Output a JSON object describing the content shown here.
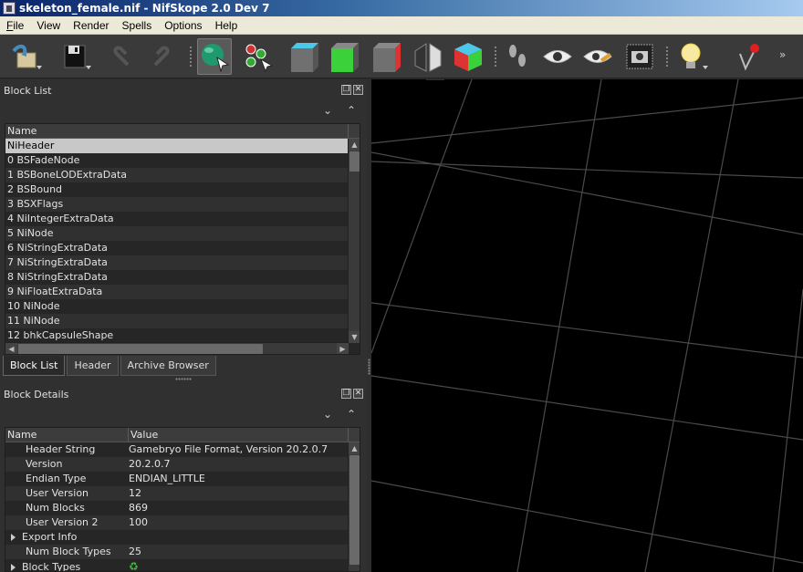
{
  "window": {
    "title": "skeleton_female.nif - NifSkope 2.0 Dev 7"
  },
  "menu": [
    {
      "label": "File",
      "mnemonic": "F",
      "rest": "ile"
    },
    {
      "label": "View",
      "mnemonic": "",
      "rest": "View"
    },
    {
      "label": "Render",
      "mnemonic": "",
      "rest": "Render"
    },
    {
      "label": "Spells",
      "mnemonic": "",
      "rest": "Spells"
    },
    {
      "label": "Options",
      "mnemonic": "",
      "rest": "Options"
    },
    {
      "label": "Help",
      "mnemonic": "",
      "rest": "Help"
    }
  ],
  "toolbar": {
    "icons": [
      "open-file-icon",
      "save-file-icon",
      "undo-icon",
      "redo-icon",
      "select-object-icon",
      "select-vertex-icon",
      "view-top-icon",
      "view-front-icon",
      "view-side-icon",
      "view-walk-icon",
      "view-flip-icon",
      "footprint-icon",
      "eye-icon",
      "eye-edit-icon",
      "screenshot-icon",
      "lightbulb-icon",
      "pin-icon"
    ],
    "more": "»",
    "colors": {
      "accent": "#2aa37a",
      "green": "#3ad13a",
      "red": "#d33",
      "cyan": "#4cc7e8"
    }
  },
  "block_list": {
    "title": "Block List",
    "header": {
      "name": "Name"
    },
    "rows": [
      "NiHeader",
      "0 BSFadeNode",
      "1 BSBoneLODExtraData",
      "2 BSBound",
      "3 BSXFlags",
      "4 NiIntegerExtraData",
      "5 NiNode",
      "6 NiStringExtraData",
      "7 NiStringExtraData",
      "8 NiStringExtraData",
      "9 NiFloatExtraData",
      "10 NiNode",
      "11 NiNode",
      "12 bhkCapsuleShape"
    ],
    "selected_index": 0
  },
  "tabs": [
    "Block List",
    "Header",
    "Archive Browser"
  ],
  "block_details": {
    "title": "Block Details",
    "header": {
      "name": "Name",
      "value": "Value"
    },
    "rows": [
      {
        "name": "Header String",
        "value": "Gamebryo File Format, Version 20.2.0.7",
        "expandable": false
      },
      {
        "name": "Version",
        "value": "20.2.0.7",
        "expandable": false
      },
      {
        "name": "Endian Type",
        "value": "ENDIAN_LITTLE",
        "expandable": false
      },
      {
        "name": "User Version",
        "value": "12",
        "expandable": false
      },
      {
        "name": "Num Blocks",
        "value": "869",
        "expandable": false
      },
      {
        "name": "User Version 2",
        "value": "100",
        "expandable": false
      },
      {
        "name": "Export Info",
        "value": "",
        "expandable": true
      },
      {
        "name": "Num Block Types",
        "value": "25",
        "expandable": false
      },
      {
        "name": "Block Types",
        "value": "",
        "expandable": true,
        "icon": "refresh-icon"
      }
    ]
  }
}
